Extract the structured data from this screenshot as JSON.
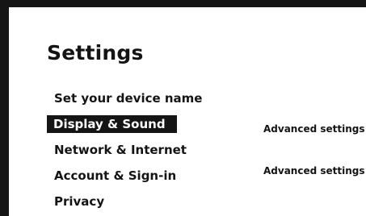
{
  "page": {
    "title": "Settings"
  },
  "menu": {
    "items": [
      {
        "label": "Set your device name",
        "selected": false
      },
      {
        "label": "Display & Sound",
        "selected": true
      },
      {
        "label": "Network & Internet",
        "selected": false
      },
      {
        "label": "Account & Sign-in",
        "selected": false
      },
      {
        "label": "Privacy",
        "selected": false
      }
    ]
  },
  "detail": {
    "links": [
      {
        "label": "Advanced settings"
      },
      {
        "label": "Advanced settings"
      }
    ]
  },
  "colors": {
    "background": "#ffffff",
    "frame": "#151515",
    "text": "#141414",
    "selected_bg": "#151515",
    "selected_text": "#ffffff"
  }
}
